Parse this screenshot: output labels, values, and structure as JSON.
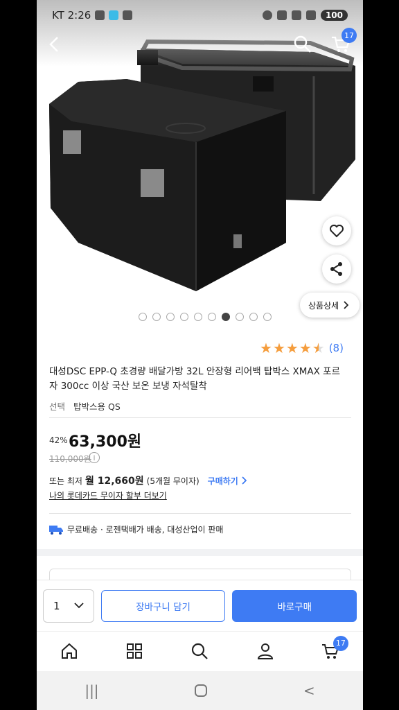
{
  "status_bar": {
    "carrier_time": "KT 2:26",
    "battery": "100"
  },
  "header": {
    "cart_count": "17"
  },
  "gallery": {
    "total_dots": 10,
    "active_index": 6,
    "detail_label": "상품상세"
  },
  "product": {
    "rating": 4.5,
    "review_count": "(8)",
    "title": "대성DSC EPP-Q 초경량 배달가방 32L 안장형 리어백 탑박스 XMAX 포르자 300cc 이상 국산 보온 보냉 자석탈착",
    "option_label": "선택",
    "option_value": "탑박스용 QS",
    "discount": "42%",
    "price": "63,300원",
    "original_price": "110,000원",
    "installment_prefix": "또는 최저",
    "installment_amount": "월 12,660원",
    "installment_detail": "(5개월 무이자)",
    "buy_link": "구매하기",
    "card_link": "나의 롯데카드 무이자 할부 더보기",
    "shipping": "무료배송 · 로젠택배가 배송, 대성산업이 판매"
  },
  "action_bar": {
    "quantity": "1",
    "add_to_cart": "장바구니 담기",
    "buy_now": "바로구매"
  },
  "bottom_nav": {
    "cart_count": "17"
  },
  "colors": {
    "accent": "#3e7bf3",
    "star": "#f59d3d"
  }
}
